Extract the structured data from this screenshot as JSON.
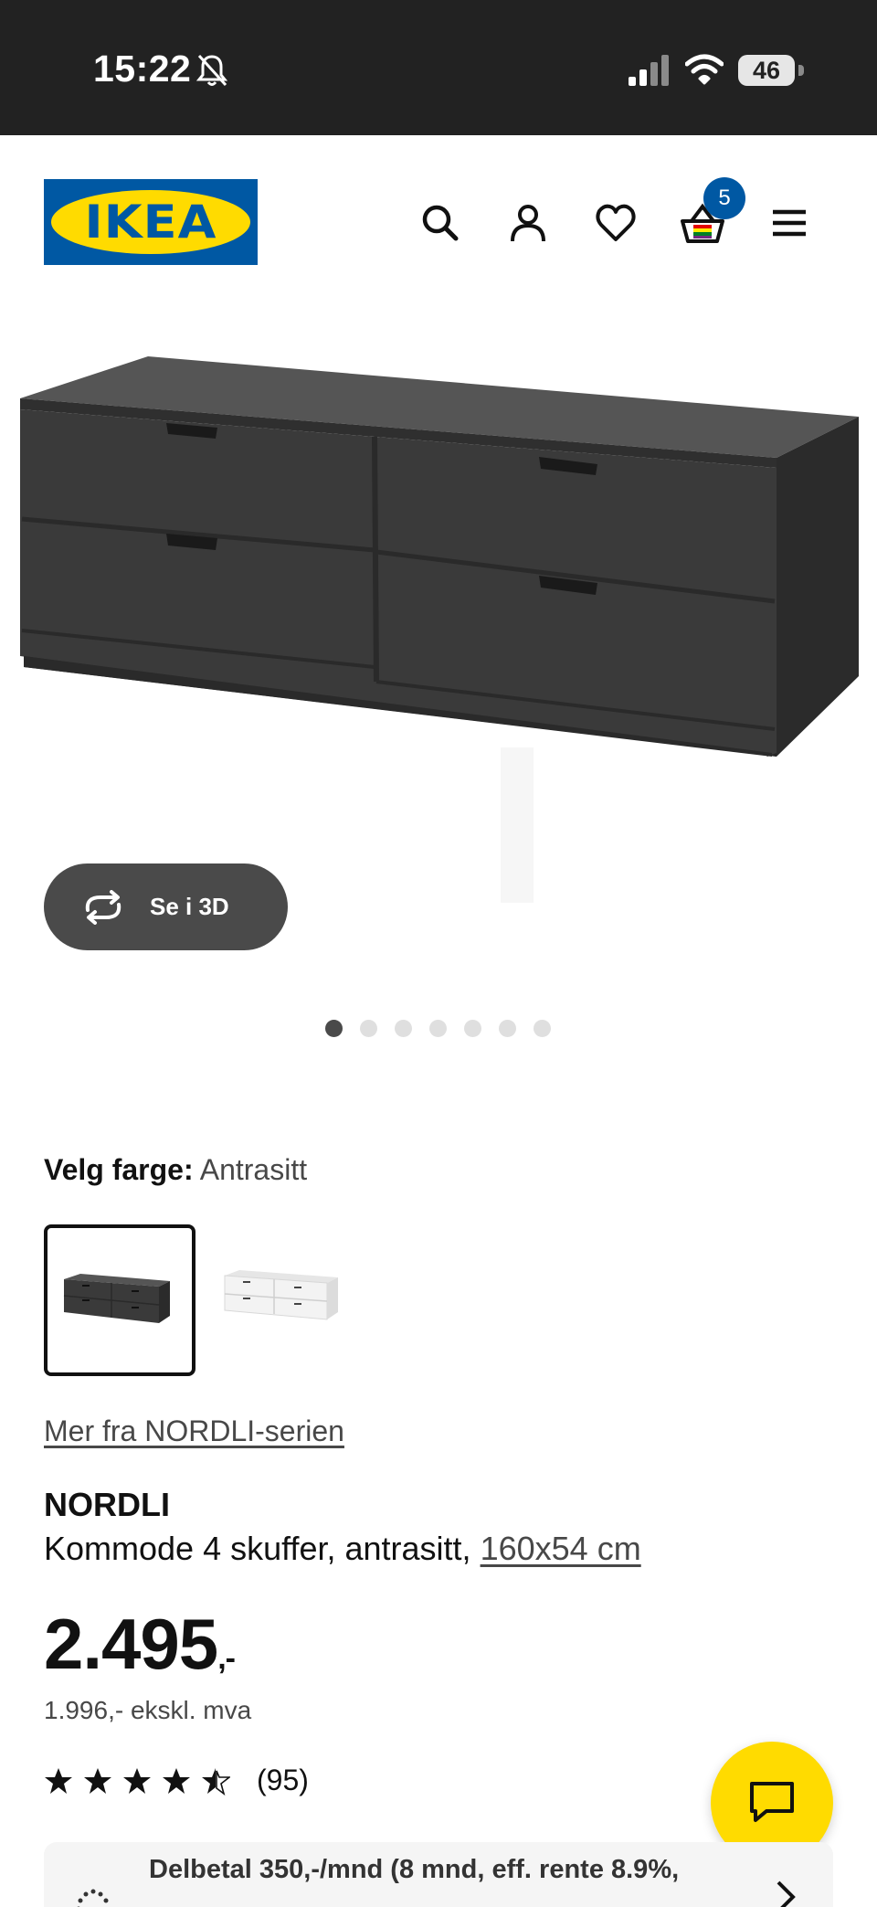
{
  "status_bar": {
    "time": "15:22",
    "battery": "46",
    "icons": [
      "bell-muted-icon",
      "signal-icon",
      "wifi-icon",
      "battery-icon"
    ]
  },
  "header": {
    "logo_text": "IKEA",
    "cart_count": "5",
    "icons": [
      "search-icon",
      "account-icon",
      "heart-icon",
      "cart-icon",
      "menu-icon"
    ]
  },
  "colors": {
    "brand_blue": "#0058a3",
    "brand_yellow": "#ffdb00",
    "product_dark": "#3a3a3a"
  },
  "gallery": {
    "view_3d_label": "Se i 3D",
    "image_count": 7,
    "active_index": 0
  },
  "color_picker": {
    "label": "Velg farge:",
    "value": "Antrasitt",
    "options": [
      {
        "name": "antrasitt",
        "selected": true
      },
      {
        "name": "white",
        "selected": false
      }
    ]
  },
  "series_link": "Mer fra NORDLI-serien",
  "product": {
    "name": "NORDLI",
    "description": "Kommode 4 skuffer, antrasitt,",
    "size": "160x54 cm",
    "price": "2.495",
    "price_suffix": ",-",
    "price_ex_vat": "1.996,- ekskl. mva",
    "rating": 4.5,
    "review_count": "(95)"
  },
  "finance": {
    "text": "Delbetal 350,-/mnd (8 mnd, eff. rente 8.9%,"
  }
}
